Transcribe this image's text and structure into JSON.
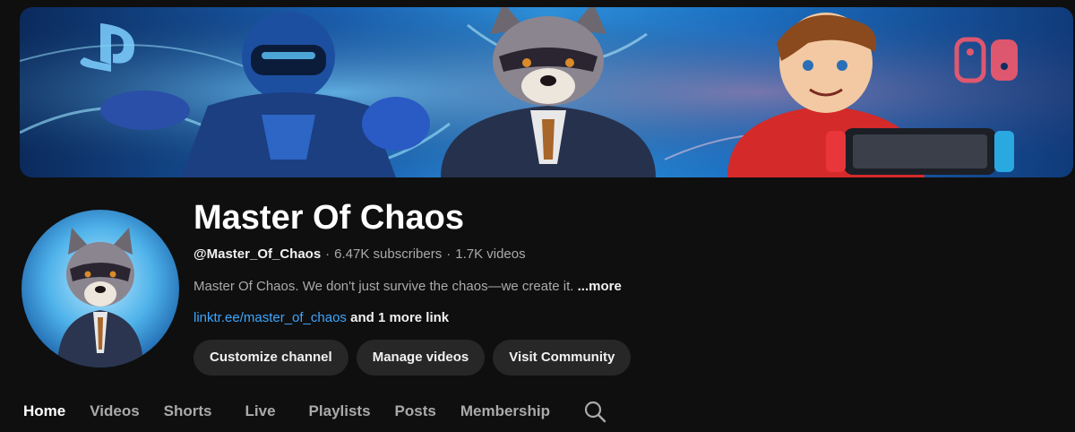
{
  "channel": {
    "name": "Master Of Chaos",
    "handle": "@Master_Of_Chaos",
    "separator": "·",
    "subscribers": "6.47K subscribers",
    "videos": "1.7K videos",
    "description": "Master Of Chaos. We don't just survive the chaos—we create it.",
    "more_label": "...more",
    "link": "linktr.ee/master_of_chaos",
    "more_links": "and 1 more link"
  },
  "actions": {
    "customize_label": "Customize channel",
    "manage_label": "Manage videos",
    "community_label": "Visit Community"
  },
  "tabs": [
    {
      "label": "Home",
      "active": true
    },
    {
      "label": "Videos"
    },
    {
      "label": "Shorts"
    },
    {
      "label": "Live"
    },
    {
      "label": "Playlists"
    },
    {
      "label": "Posts"
    },
    {
      "label": "Membership"
    }
  ],
  "icons": {
    "search": "search-icon",
    "banner_left": "playstation-logo-icon",
    "banner_right": "nintendo-switch-logo-icon"
  },
  "colors": {
    "background": "#0f0f0f",
    "link": "#3ea6ff",
    "button_bg": "#272727",
    "text_primary": "#f1f1f1",
    "text_secondary": "#aaaaaa"
  }
}
